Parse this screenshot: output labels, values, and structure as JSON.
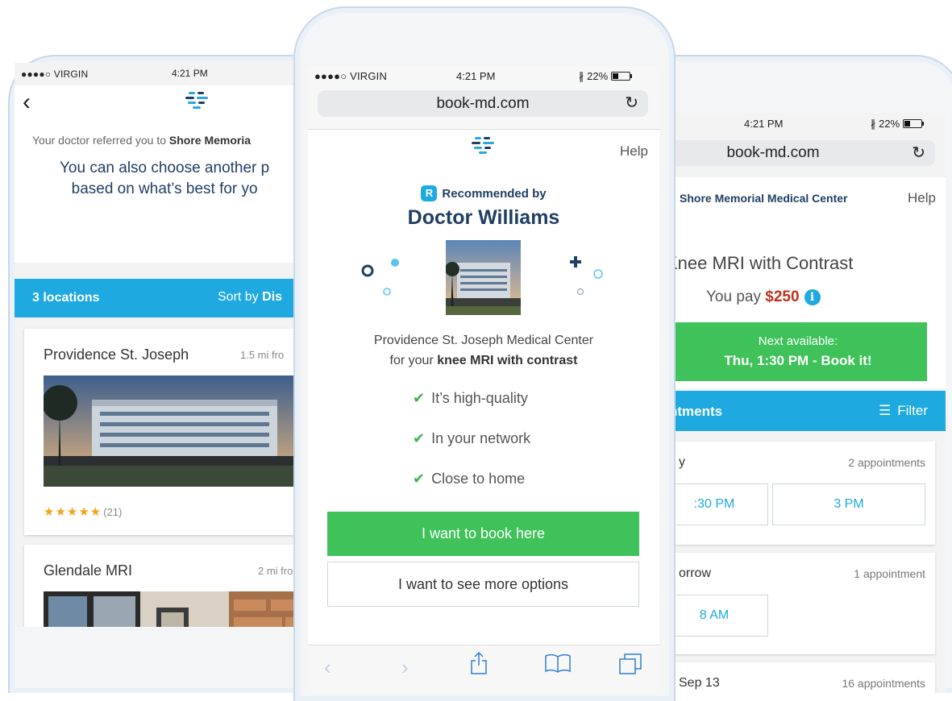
{
  "status": {
    "carrier": "●●●●○ VIRGIN",
    "time": "4:21 PM",
    "battery": "22%"
  },
  "url": "book-md.com",
  "left": {
    "referral_prefix": "Your doctor referred you to ",
    "referral_name": "Shore Memoria",
    "choose_line1": "You can also choose another p",
    "choose_line2": "based on what’s best for yo",
    "count_label": "3 locations",
    "sort_prefix": "Sort by ",
    "sort_value": "Dis",
    "cards": [
      {
        "name": "Providence St. Joseph",
        "distance": "1.5 mi fro",
        "rating": 5,
        "review_count": "(21)"
      },
      {
        "name": "Glendale MRI",
        "distance": "2 mi fro"
      }
    ]
  },
  "center": {
    "help": "Help",
    "recommended_badge": "R",
    "recommended_by": "Recommended by",
    "doctor": "Doctor Williams",
    "hospital_line1": "Providence St. Joseph Medical Center",
    "hospital_prefix": "for your ",
    "procedure": "knee MRI with contrast",
    "checks": [
      "It’s high-quality",
      "In your network",
      "Close to home"
    ],
    "book_label": "I want to book here",
    "more_label": "I want to see more options"
  },
  "right": {
    "center_name": "Shore Memorial Medical Center",
    "help": "Help",
    "procedure_title": "Knee MRI with Contrast",
    "pay_prefix": "You pay ",
    "pay_amount": "$250",
    "info_glyph": "i",
    "next_line1": "Next available:",
    "next_line2": "Thu, 1:30 PM - Book it!",
    "appointments_label": "ntments",
    "filter_label": "Filter",
    "days": [
      {
        "label": "y",
        "count": "2 appointments",
        "slots": [
          ":30 PM",
          "3 PM"
        ]
      },
      {
        "label": "orrow",
        "count": "1 appointment",
        "slots": [
          "8 AM"
        ]
      },
      {
        "label": "Sep 13",
        "count": "16 appointments",
        "slots": []
      }
    ]
  },
  "colors": {
    "brand_blue": "#1fa9e1",
    "navy": "#1f3f63",
    "green": "#3fc25a",
    "price_red": "#c0311a",
    "star": "#f3a21c"
  }
}
